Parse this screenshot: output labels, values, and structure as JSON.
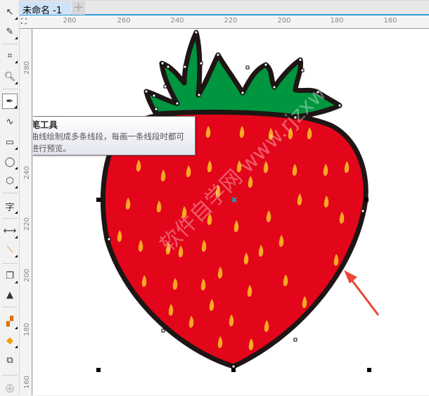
{
  "document_tab": {
    "title": "未命名 -1",
    "add_label": "+"
  },
  "ruler_top_ticks": [
    "280",
    "260",
    "240",
    "220",
    "200",
    "180",
    "160"
  ],
  "ruler_left_ticks": [
    "280",
    "240",
    "220",
    "200",
    "180",
    "160"
  ],
  "toolbox": [
    "pick-tool",
    "shape-tool",
    "crop-tool",
    "zoom-tool",
    "pen-tool",
    "artistic-media-tool",
    "rectangle-tool",
    "ellipse-tool",
    "polygon-tool",
    "text-tool",
    "dimension-tool",
    "connector-tool",
    "drop-shadow-tool",
    "transparency-tool",
    "eyedropper-tool",
    "interactive-fill-tool",
    "smart-fill-tool",
    "add-tool"
  ],
  "tooltip": {
    "title": "钢笔工具",
    "line1": "将曲线绘制成多条线段，每画一条线段时都可",
    "line2": "以进行预览。"
  },
  "watermark": "软件自学网 www.rjzxw.com",
  "colors": {
    "body": "#e3051a",
    "leaf": "#00963f",
    "outline": "#1e1614",
    "seed": "#f7a823",
    "arrow": "#e8463a",
    "accent": "#2a9ad8"
  }
}
